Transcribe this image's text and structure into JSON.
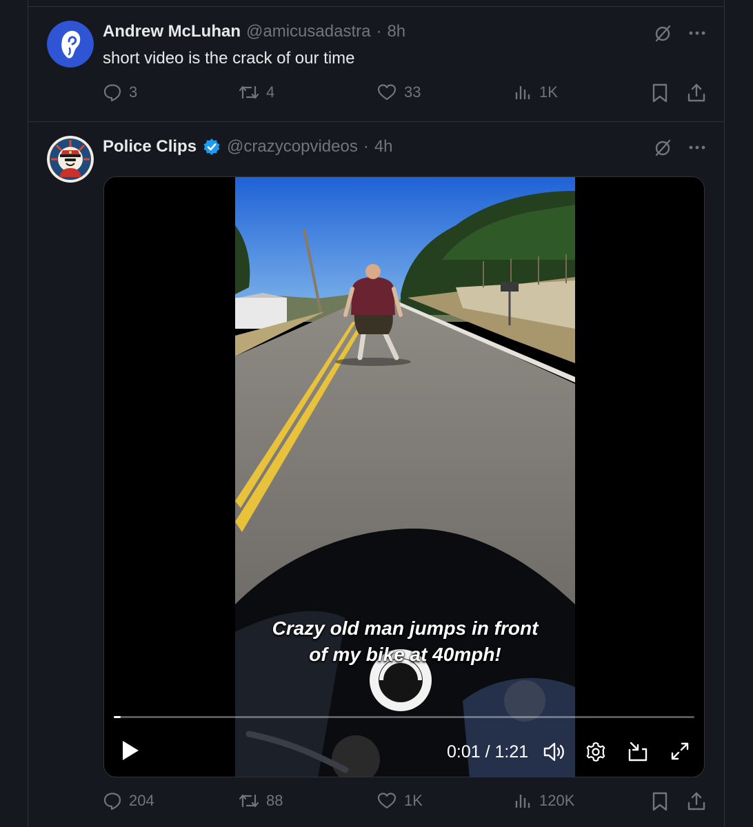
{
  "posts": [
    {
      "display_name": "Andrew McLuhan",
      "handle": "@amicusadastra",
      "separator": "·",
      "time": "8h",
      "text": "short video is the crack of our time",
      "avatar_icon": "ear-avatar-icon",
      "stats": {
        "replies": "3",
        "reposts": "4",
        "likes": "33",
        "views": "1K"
      }
    },
    {
      "display_name": "Police Clips",
      "handle": "@crazycopvideos",
      "separator": "·",
      "time": "4h",
      "verified": true,
      "avatar_icon": "police-officer-avatar-icon",
      "video": {
        "caption_line1": "Crazy old man jumps in front",
        "caption_line2": "of my bike at 40mph!",
        "time_display": "0:01 / 1:21",
        "progress": 0.012
      },
      "stats": {
        "replies": "204",
        "reposts": "88",
        "likes": "1K",
        "views": "120K"
      }
    }
  ],
  "colors": {
    "background": "#15181e",
    "muted": "#71767b",
    "text": "#e7e9ea",
    "verified_blue": "#1d9bf0"
  }
}
